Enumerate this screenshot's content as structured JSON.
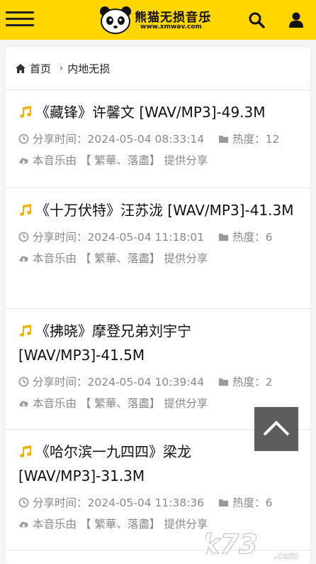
{
  "header": {
    "logo_text": "熊猫无损音乐",
    "logo_url": "www.xmwav.com",
    "colors": {
      "bar": "#ffd600"
    }
  },
  "breadcrumb": {
    "home": "首页",
    "current": "内地无损"
  },
  "items": [
    {
      "title": "《藏锋》许馨文 [WAV/MP3]-49.3M",
      "time_label": "分享时间：",
      "time": "2024-05-04 08:33:14",
      "heat_label": "热度：",
      "heat": "12",
      "by_prefix": "本音乐由",
      "by_user": "【 繁華、落盡】",
      "by_suffix": "提供分享"
    },
    {
      "title": "《十万伏特》汪苏泷 [WAV/MP3]-41.3M",
      "time_label": "分享时间：",
      "time": "2024-05-04 11:18:01",
      "heat_label": "热度：",
      "heat": "6",
      "by_prefix": "本音乐由",
      "by_user": "【 繁華、落盡】",
      "by_suffix": "提供分享"
    },
    {
      "title": "《拂晓》摩登兄弟刘宇宁 [WAV/MP3]-41.5M",
      "time_label": "分享时间：",
      "time": "2024-05-04 10:39:44",
      "heat_label": "热度：",
      "heat": "2",
      "by_prefix": "本音乐由",
      "by_user": "【 繁華、落盡】",
      "by_suffix": "提供分享"
    },
    {
      "title": "《哈尔滨一九四四》梁龙 [WAV/MP3]-31.3M",
      "time_label": "分享时间：",
      "time": "2024-05-04 11:38:36",
      "heat_label": "热度：",
      "heat": "6",
      "by_prefix": "本音乐由",
      "by_user": "【 繁華、落盡】",
      "by_suffix": "提供分享"
    }
  ],
  "watermark": "k73.com"
}
